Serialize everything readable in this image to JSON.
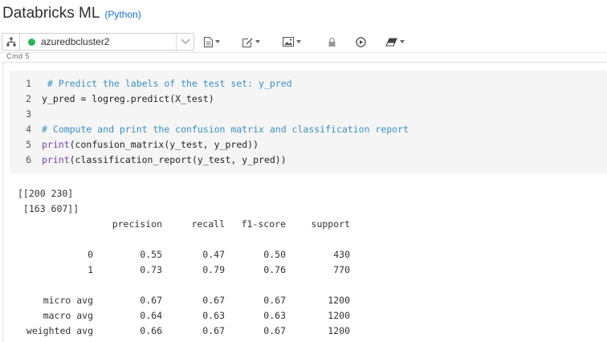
{
  "notebook": {
    "title": "Databricks ML",
    "language": "(Python)"
  },
  "toolbar": {
    "cluster_name": "azuredbcluster2",
    "cluster_status_color": "#2fb355"
  },
  "cell": {
    "cmd_label": "Cmd 5",
    "code_lines": [
      {
        "n": "1",
        "text": " # Predict the labels of the test set: y_pred",
        "type": "comment"
      },
      {
        "n": "2",
        "text": "y_pred = logreg.predict(X_test)",
        "type": "code"
      },
      {
        "n": "3",
        "text": "",
        "type": "code"
      },
      {
        "n": "4",
        "text": "# Compute and print the confusion matrix and classification report",
        "type": "comment"
      },
      {
        "n": "5",
        "kw": "print",
        "rest": "(confusion_matrix(y_test, y_pred))",
        "type": "print"
      },
      {
        "n": "6",
        "kw": "print",
        "rest": "(classification_report(y_test, y_pred))",
        "type": "print"
      }
    ]
  },
  "output": {
    "matrix_lines": [
      "[[200 230]",
      " [163 607]]"
    ],
    "report_headers": [
      "precision",
      "recall",
      "f1-score",
      "support"
    ],
    "report_rows": [
      {
        "label": "0",
        "values": [
          "0.55",
          "0.47",
          "0.50",
          "430"
        ]
      },
      {
        "label": "1",
        "values": [
          "0.73",
          "0.79",
          "0.76",
          "770"
        ]
      },
      {
        "label": "micro avg",
        "values": [
          "0.67",
          "0.67",
          "0.67",
          "1200"
        ]
      },
      {
        "label": "macro avg",
        "values": [
          "0.64",
          "0.63",
          "0.63",
          "1200"
        ]
      },
      {
        "label": "weighted avg",
        "values": [
          "0.66",
          "0.67",
          "0.67",
          "1200"
        ]
      }
    ]
  }
}
